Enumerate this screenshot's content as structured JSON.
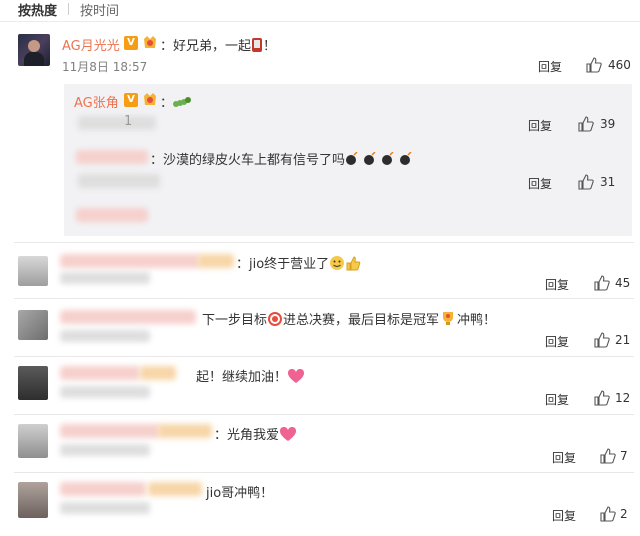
{
  "sort": {
    "hot": "按热度",
    "time": "按时间"
  },
  "main_comment": {
    "username": "AG月光光",
    "verified": "V",
    "text": "：好兄弟，一起",
    "text_end": "！",
    "date": "11月8日 18:57",
    "reply_label": "回复",
    "likes": "460"
  },
  "replies": [
    {
      "username": "AG张角",
      "verified": "V",
      "text": "：",
      "partial": "1",
      "reply_label": "回复",
      "likes": "39"
    },
    {
      "text": "：沙漠的绿皮火车上都有信号了吗",
      "reply_label": "回复",
      "likes": "31"
    }
  ],
  "comments": [
    {
      "text": "：jio终于营业了",
      "reply_label": "回复",
      "likes": "45"
    },
    {
      "text": "下一步目标",
      "text2": "进总决赛，最后目标是冠军",
      "text3": "冲鸭！",
      "reply_label": "回复",
      "likes": "21"
    },
    {
      "text": "起！继续加油！",
      "reply_label": "回复",
      "likes": "12"
    },
    {
      "text": "：光角我爱",
      "reply_label": "回复",
      "likes": "7"
    },
    {
      "text": "jio哥冲鸭！",
      "reply_label": "回复",
      "likes": "2"
    }
  ],
  "colors": {
    "username": "#eb7350",
    "badge": "#f59d14",
    "reply_bg": "#f2f2f5"
  },
  "icons": [
    "thumbs-up-icon",
    "verified-badge-icon",
    "medal-icon",
    "smile-icon"
  ]
}
